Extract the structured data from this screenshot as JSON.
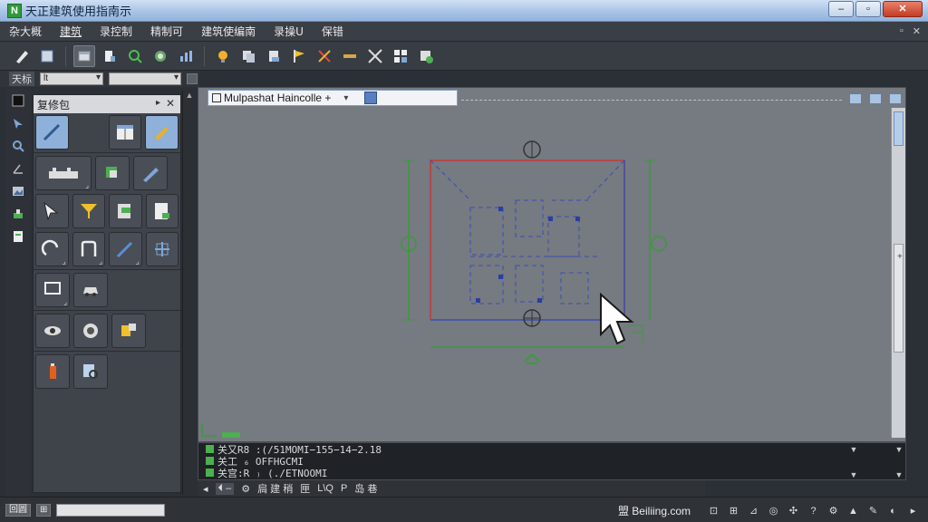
{
  "window": {
    "title": "天正建筑使用指南示",
    "app_icon": "N",
    "controls": {
      "minimize": "–",
      "maximize": "▫",
      "close": "✕"
    }
  },
  "menu": {
    "items": [
      "杂大概",
      "建筑",
      "录控制",
      "精制可",
      "建筑使编南",
      "录操U",
      "保错"
    ],
    "mdi_controls": {
      "restore": "▫",
      "close": "✕"
    }
  },
  "strip": {
    "label": "天标",
    "combo1": "lt",
    "combo2": ""
  },
  "palette": {
    "title": "复修包",
    "pin": "▸",
    "close": "✕"
  },
  "document_tab": {
    "label": "Mulpashat Haincolle +",
    "caret": "▾"
  },
  "vscroll_labels": {
    "plus": "+",
    "minus": "–"
  },
  "command": {
    "lines": [
      "关又R8 :(/51MOMI−155−14−2.18",
      "关工 ₆ OFFHGCMI",
      "关宫:R ₎ (./ETNOOMI"
    ],
    "scroll_up": "▲",
    "scroll_down": "▼"
  },
  "layout_tabs": {
    "items": [
      "◂",
      "⏴ –",
      "⚙",
      "扃 建 稍",
      "匣",
      "L\\Q",
      "P",
      "岛 巷"
    ]
  },
  "status": {
    "left_boxes": [
      "回圆",
      "⊞"
    ],
    "brand": "盟 Beiliing.com"
  },
  "colors": {
    "drawing_bg": "#767a81",
    "red_line": "#c23a3a",
    "green_line": "#3c9a3c",
    "blue_line": "#3a4fb0"
  }
}
